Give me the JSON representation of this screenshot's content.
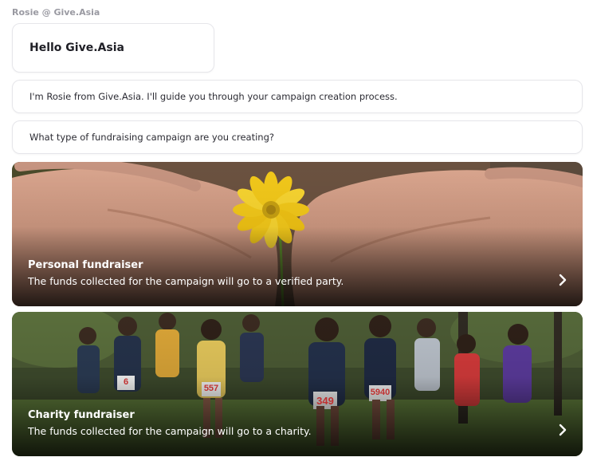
{
  "chat": {
    "sender": "Rosie @ Give.Asia",
    "greeting": "Hello Give.Asia",
    "messages": [
      "I'm Rosie from Give.Asia. I'll guide you through your campaign creation process.",
      "What type of fundraising campaign are you creating?"
    ]
  },
  "options": [
    {
      "title": "Personal fundraiser",
      "description": "The funds collected for the campaign will go to a verified party.",
      "image": "hands-holding-flower",
      "icon": "chevron-right-icon"
    },
    {
      "title": "Charity fundraiser",
      "description": "The funds collected for the campaign will go to a charity.",
      "image": "runners-race",
      "icon": "chevron-right-icon"
    }
  ],
  "colors": {
    "flower": "#f2c81a",
    "overlay": "#000000",
    "sender_text": "#9a9aa2"
  },
  "runner_bibs": [
    "5940",
    "349",
    "557",
    "6"
  ]
}
